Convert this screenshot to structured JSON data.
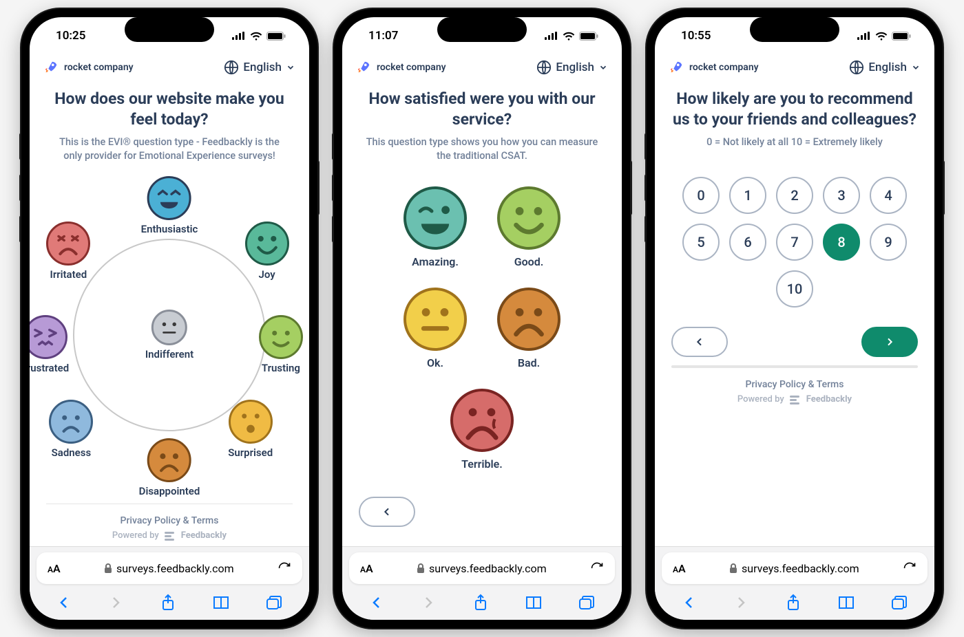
{
  "company": "rocket company",
  "language": "English",
  "footer": {
    "privacy": "Privacy Policy & Terms",
    "powered_prefix": "Powered by",
    "powered_brand": "Feedbackly"
  },
  "safari": {
    "url": "surveys.feedbackly.com",
    "aa_small": "A",
    "aa_big": "A"
  },
  "phones": [
    {
      "time": "10:25",
      "title": "How does our website make you feel today?",
      "subtitle": "This is the EVI® question type - Feedbackly is the only provider for Emotional Experience surveys!",
      "emotions": {
        "center": "Indifferent",
        "ring": [
          "Enthusiastic",
          "Joy",
          "Trusting",
          "Surprised",
          "Disappointed",
          "Sadness",
          "Frustrated",
          "Irritated"
        ]
      }
    },
    {
      "time": "11:07",
      "title": "How satisfied were you with our service?",
      "subtitle": "This question type shows you how you can measure the traditional CSAT.",
      "csat": [
        "Amazing.",
        "Good.",
        "Ok.",
        "Bad.",
        "Terrible."
      ]
    },
    {
      "time": "10:55",
      "title": "How likely are you to recommend us to your friends and colleagues?",
      "subtitle": "0 = Not likely at all 10 = Extremely likely",
      "nps": {
        "options": [
          "0",
          "1",
          "2",
          "3",
          "4",
          "5",
          "6",
          "7",
          "8",
          "9",
          "10"
        ],
        "selected": "8"
      }
    }
  ],
  "colors": {
    "text": "#2b3d58",
    "subtext": "#728199",
    "accent": "#0f8b6c",
    "safari_blue": "#0a7bff",
    "faces": {
      "enthusiastic": "#4bb0d5",
      "joy": "#59b99a",
      "trusting": "#a5cf62",
      "surprised": "#f0bb44",
      "disappointed": "#d58a3d",
      "sadness": "#8fb9dd",
      "frustrated": "#b79ad6",
      "irritated": "#e07a78",
      "indifferent": "#c8ccd2",
      "amazing": "#6bc0b0",
      "good": "#a5cf62",
      "ok": "#f2cf4a",
      "bad": "#d58a3d",
      "terrible": "#d66c6a"
    }
  }
}
